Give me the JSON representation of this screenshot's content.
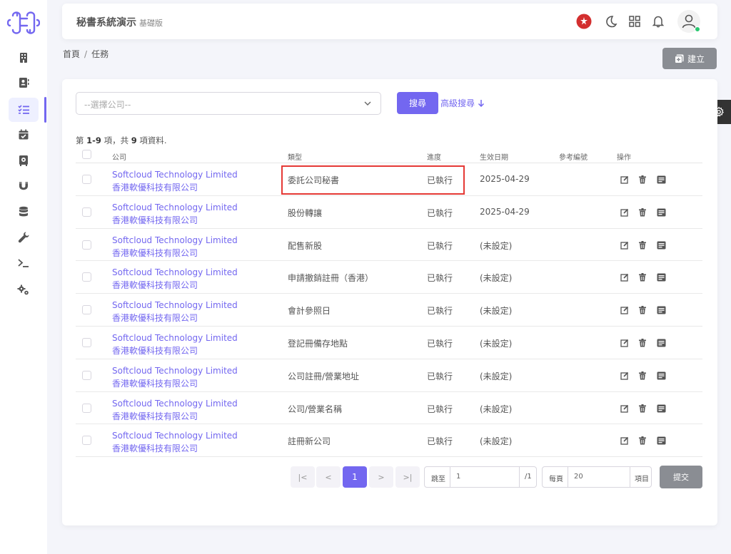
{
  "app": {
    "title": "秘書系統演示",
    "edition": "基礎版"
  },
  "breadcrumb": {
    "home": "首頁",
    "sep": "/",
    "current": "任務"
  },
  "toolbar": {
    "create_label": "建立"
  },
  "filter": {
    "company_placeholder": "--選擇公司--",
    "search_label": "搜尋",
    "advanced_label": "高級搜尋"
  },
  "summary": {
    "prefix": "第 ",
    "range": "1-9",
    "mid": " 項，共 ",
    "total": "9",
    "suffix": " 項資料."
  },
  "table": {
    "columns": {
      "company": "公司",
      "type": "類型",
      "progress": "進度",
      "date": "生效日期",
      "ref": "參考編號",
      "actions": "操作"
    },
    "rows": [
      {
        "company_en": "Softcloud Technology Limited",
        "company_zh": "香港軟優科技有限公司",
        "type": "委託公司秘書",
        "progress": "已執行",
        "date": "2025-04-29",
        "ref": ""
      },
      {
        "company_en": "Softcloud Technology Limited",
        "company_zh": "香港軟優科技有限公司",
        "type": "股份轉讓",
        "progress": "已執行",
        "date": "2025-04-29",
        "ref": ""
      },
      {
        "company_en": "Softcloud Technology Limited",
        "company_zh": "香港軟優科技有限公司",
        "type": "配售新股",
        "progress": "已執行",
        "date": "(未設定)",
        "ref": ""
      },
      {
        "company_en": "Softcloud Technology Limited",
        "company_zh": "香港軟優科技有限公司",
        "type": "申請撤銷註冊（香港）",
        "progress": "已執行",
        "date": "(未設定)",
        "ref": ""
      },
      {
        "company_en": "Softcloud Technology Limited",
        "company_zh": "香港軟優科技有限公司",
        "type": "會計參照日",
        "progress": "已執行",
        "date": "(未設定)",
        "ref": ""
      },
      {
        "company_en": "Softcloud Technology Limited",
        "company_zh": "香港軟優科技有限公司",
        "type": "登記冊備存地點",
        "progress": "已執行",
        "date": "(未設定)",
        "ref": ""
      },
      {
        "company_en": "Softcloud Technology Limited",
        "company_zh": "香港軟優科技有限公司",
        "type": "公司註冊/營業地址",
        "progress": "已執行",
        "date": "(未設定)",
        "ref": ""
      },
      {
        "company_en": "Softcloud Technology Limited",
        "company_zh": "香港軟優科技有限公司",
        "type": "公司/營業名稱",
        "progress": "已執行",
        "date": "(未設定)",
        "ref": ""
      },
      {
        "company_en": "Softcloud Technology Limited",
        "company_zh": "香港軟優科技有限公司",
        "type": "註冊新公司",
        "progress": "已執行",
        "date": "(未設定)",
        "ref": ""
      }
    ]
  },
  "pagination": {
    "first": "|<",
    "prev": "<",
    "current": "1",
    "next": ">",
    "last": ">|",
    "jump_label": "跳至",
    "jump_value": "1",
    "total_pages": "/1",
    "per_page_label": "每頁",
    "per_page_value": "20",
    "per_page_unit": "項目",
    "submit_label": "提交"
  },
  "colors": {
    "accent": "#7367f0",
    "highlight": "#e53935",
    "online": "#28c76f"
  },
  "icons": {
    "sidebar": [
      "building-icon",
      "contacts-icon",
      "task-list-icon",
      "calendar-check-icon",
      "vault-icon",
      "magnet-icon",
      "database-icon",
      "wrench-icon",
      "terminal-icon",
      "gears-icon"
    ],
    "header": [
      "hk-flag-icon",
      "moon-icon",
      "grid-icon",
      "bell-icon",
      "user-icon"
    ],
    "row_actions": [
      "edit-icon",
      "trash-icon",
      "details-icon"
    ]
  }
}
